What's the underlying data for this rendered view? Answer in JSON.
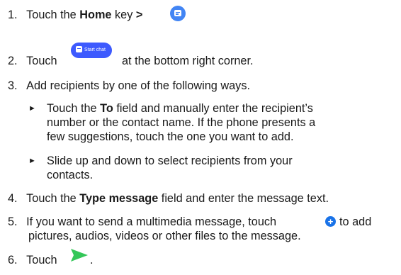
{
  "steps": {
    "s1": {
      "num": "1.",
      "pre": "Touch the ",
      "bold": "Home",
      "post": " key ",
      "arrow": ">",
      "icon": "messages-app-icon"
    },
    "s2": {
      "num": "2.",
      "pre": "Touch",
      "button_label": "Start chat",
      "post": "at the bottom right corner."
    },
    "s3": {
      "num": "3.",
      "text": "Add recipients by one of the following ways.",
      "bullets": [
        {
          "marker": "►",
          "line1_pre": "Touch the ",
          "line1_bold": "To",
          "line1_post": " field and manually enter the recipient’s",
          "line2": "number or the contact name. If the phone presents a",
          "line3": "few suggestions, touch the one you want to add."
        },
        {
          "marker": "►",
          "line1": "Slide up and down to select recipients from your",
          "line2": "contacts."
        }
      ]
    },
    "s4": {
      "num": "4.",
      "pre": "Touch the ",
      "bold": "Type message",
      "post": " field and enter the message text."
    },
    "s5": {
      "num": "5.",
      "line1_pre": "If you want to send a multimedia message, touch ",
      "line1_post": " to add",
      "line2": "pictures, audios, videos or other files to the message.",
      "icon": "add-attachment-icon"
    },
    "s6": {
      "num": "6.",
      "pre": "Touch",
      "post": ".",
      "icon": "send-icon"
    }
  },
  "colors": {
    "text": "#1a1a1a",
    "messages_icon": "#4285f4",
    "start_chat_button": "#3d5afe",
    "plus_icon": "#1a73e8",
    "send_icon": "#34c759"
  }
}
